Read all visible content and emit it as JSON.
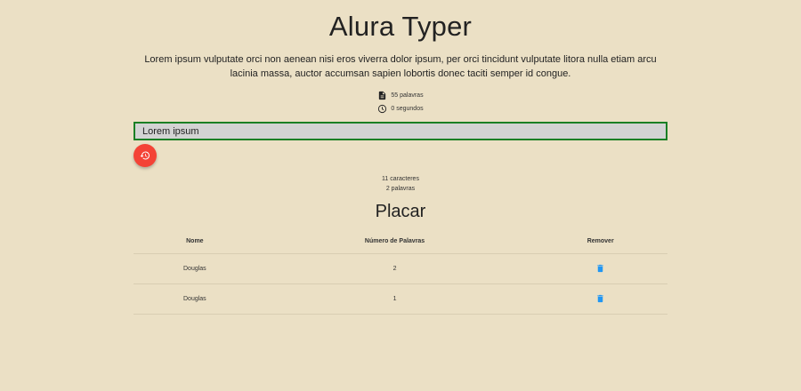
{
  "app": {
    "title": "Alura Typer",
    "phrase": "Lorem ipsum vulputate orci non aenean nisi eros viverra dolor ipsum, per orci tincidunt vulputate litora nulla etiam arcu lacinia massa, auctor accumsan sapien lobortis donec taciti semper id congue."
  },
  "stats": {
    "words": "55 palavras",
    "words_icon": "document-icon",
    "time": "0 segundos",
    "time_icon": "clock-icon"
  },
  "typing": {
    "value": "Lorem ipsum",
    "border_color": "#1b7f24"
  },
  "restart": {
    "icon": "history-restart-icon",
    "color": "#f44336"
  },
  "counters": {
    "chars": "11 caracteres",
    "words": "2 palavras"
  },
  "placar": {
    "title": "Placar",
    "columns": [
      "Nome",
      "Número de Palavras",
      "Remover"
    ],
    "rows": [
      {
        "name": "Douglas",
        "count": "2",
        "remove_icon": "trash-icon"
      },
      {
        "name": "Douglas",
        "count": "1",
        "remove_icon": "trash-icon"
      }
    ],
    "trash_color": "#2196f3"
  }
}
